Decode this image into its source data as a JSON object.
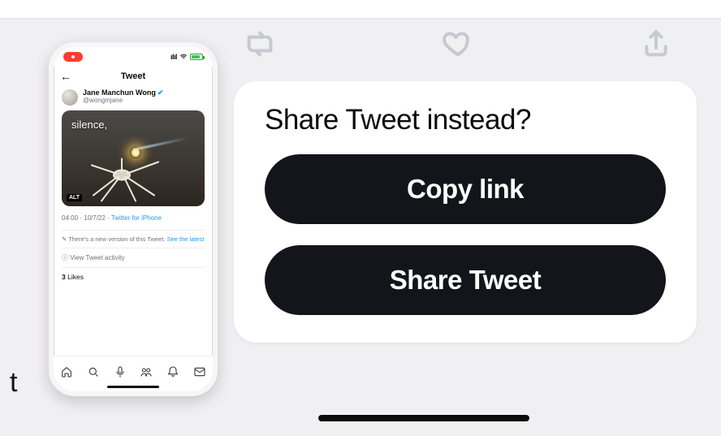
{
  "modal": {
    "title": "Share Tweet instead?",
    "copy_link_label": "Copy link",
    "share_tweet_label": "Share Tweet"
  },
  "phone": {
    "header_title": "Tweet",
    "status_signal": "ılıl",
    "status_wifi": "▴",
    "user": {
      "name": "Jane Manchun Wong",
      "handle": "@wongmjane"
    },
    "image_caption": "silence,",
    "alt_badge": "ALT",
    "meta": {
      "time": "04:00",
      "date": "10/7/22",
      "client": "Twitter for iPhone"
    },
    "edit_note_prefix": "✎ There's a new version of this Tweet. ",
    "edit_note_link": "See the latest",
    "activity": "ⓘ View Tweet activity",
    "likes_count": "3",
    "likes_label": " Likes"
  },
  "icons": {
    "retweet": "retweet-icon",
    "like": "heart-icon",
    "share": "share-icon"
  }
}
